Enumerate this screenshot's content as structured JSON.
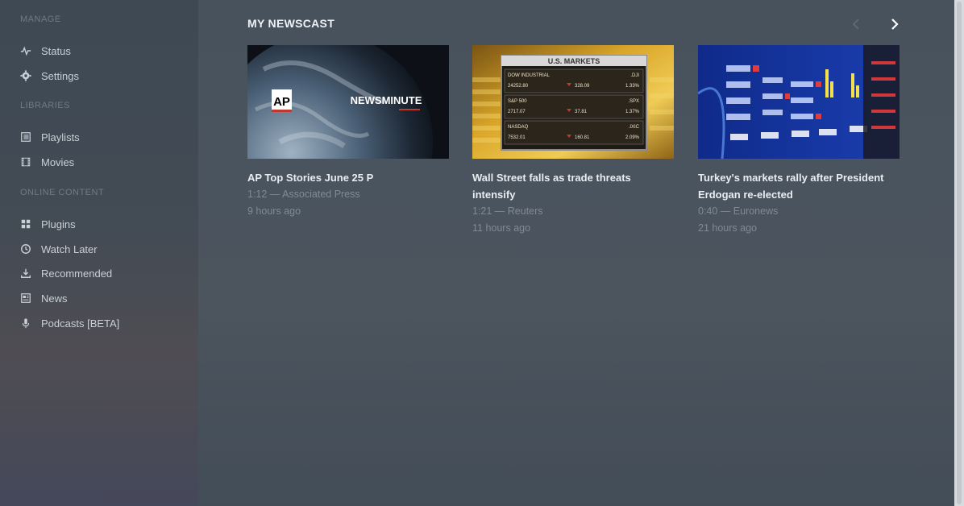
{
  "sidebar": {
    "sections": [
      {
        "title": "MANAGE",
        "items": [
          {
            "label": "Status",
            "icon": "pulse-icon"
          },
          {
            "label": "Settings",
            "icon": "gear-icon"
          }
        ]
      },
      {
        "title": "LIBRARIES",
        "items": [
          {
            "label": "Playlists",
            "icon": "list-icon"
          },
          {
            "label": "Movies",
            "icon": "film-icon"
          }
        ]
      },
      {
        "title": "ONLINE CONTENT",
        "items": [
          {
            "label": "Plugins",
            "icon": "grid-icon"
          },
          {
            "label": "Watch Later",
            "icon": "clock-icon"
          },
          {
            "label": "Recommended",
            "icon": "download-icon"
          },
          {
            "label": "News",
            "icon": "newspaper-icon"
          },
          {
            "label": "Podcasts [BETA]",
            "icon": "microphone-icon"
          }
        ]
      }
    ]
  },
  "newscast": {
    "title": "MY NEWSCAST",
    "items": [
      {
        "title": "AP Top Stories June 25 P",
        "duration_source": "1:12 — Associated Press",
        "age": "9 hours ago",
        "thumb_text": "NEWSMINUTE",
        "thumb_logo": "AP"
      },
      {
        "title_line1": "Wall Street falls as trade threats",
        "title_line2": "intensify",
        "duration_source": "1:21 — Reuters",
        "age": "11 hours ago",
        "thumb_text": "U.S. MARKETS"
      },
      {
        "title_line1": "Turkey's markets rally after President",
        "title_line2": "Erdogan re-elected",
        "duration_source": "0:40 — Euronews",
        "age": "21 hours ago"
      }
    ]
  },
  "market_board": {
    "rows": [
      {
        "name": "DOW INDUSTRIAL",
        "code": ".DJI",
        "value": "24252.80",
        "change": "328.09",
        "pct": "1.33%"
      },
      {
        "name": "S&P 500",
        "code": ".SPX",
        "value": "2717.07",
        "change": "37.81",
        "pct": "1.37%"
      },
      {
        "name": "NASDAQ",
        "code": ".IXIC",
        "value": "7532.01",
        "change": "160.81",
        "pct": "2.09%"
      }
    ]
  },
  "colors": {
    "accent_red": "#c0392b",
    "gold": "#d4a022"
  }
}
